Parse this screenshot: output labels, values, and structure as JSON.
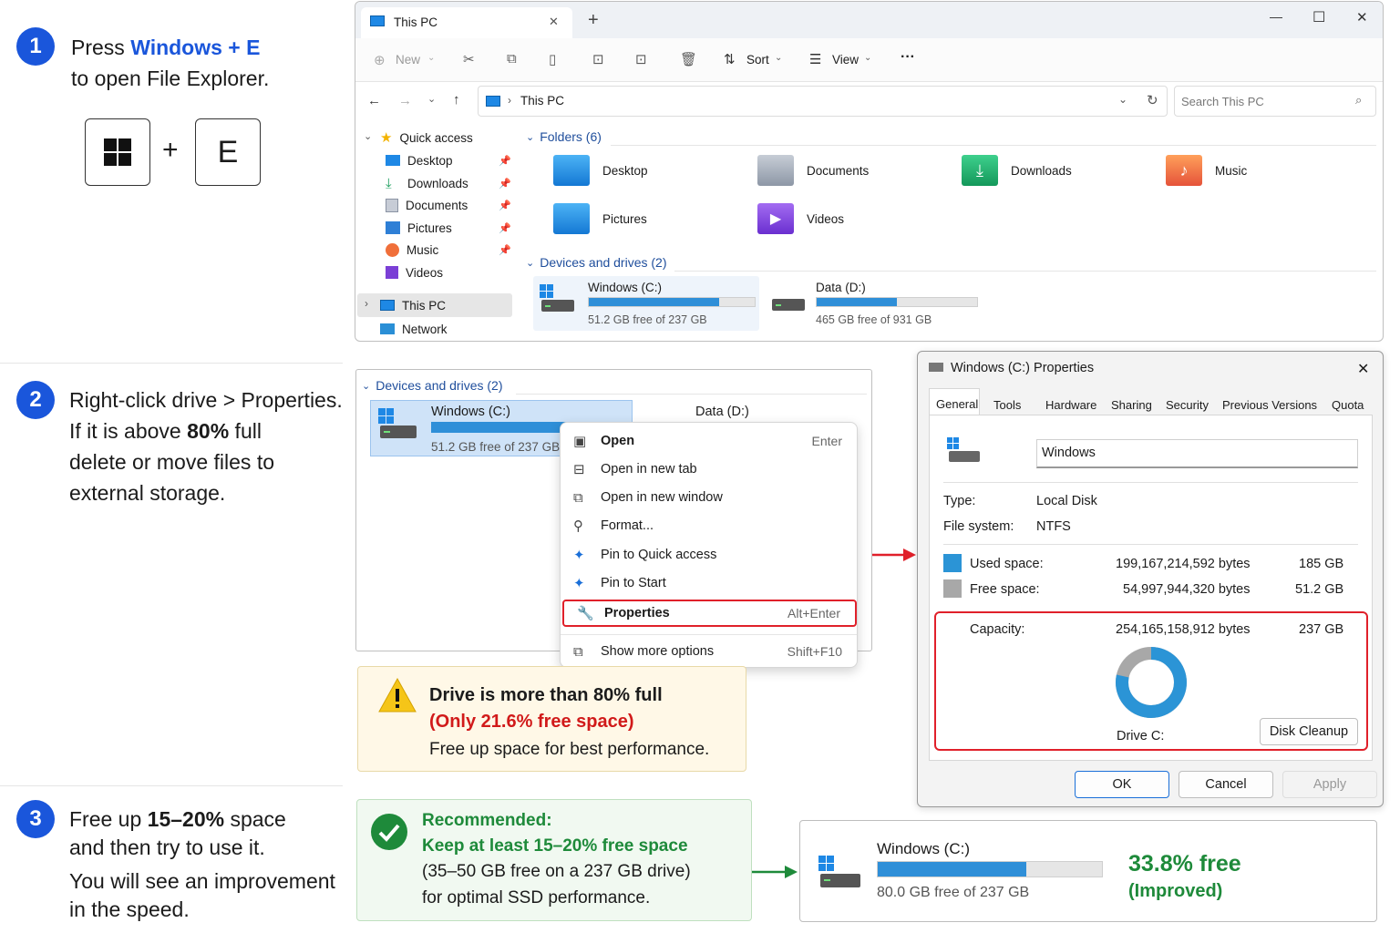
{
  "step1": {
    "num": "1",
    "line1_pre": "Press ",
    "line1_key": "Windows + E",
    "line2": "to open File Explorer.",
    "key_plus": "+",
    "key_e": "E"
  },
  "step2": {
    "num": "2",
    "line1": "Right-click drive > Properties.",
    "line2_pre": "If it is above ",
    "line2_bold": "80%",
    "line2_post": " full",
    "line3": "delete or move files to",
    "line4": "external storage."
  },
  "step3": {
    "num": "3",
    "line1_pre": "Free up ",
    "line1_bold": "15–20%",
    "line1_post": " space",
    "line2": "and then try to use it.",
    "line3": "You will see an improvement",
    "line4": "in the speed."
  },
  "explorer": {
    "tab_title": "This PC",
    "new_tab": "+",
    "window_controls": {
      "minimize": "—",
      "maximize": "☐",
      "close": "✕"
    },
    "toolbar": {
      "new": "New",
      "sort": "Sort",
      "view": "View",
      "more": "···"
    },
    "address": "This PC",
    "search_placeholder": "Search This PC",
    "nav": {
      "quick_access": "Quick access",
      "items": [
        "Desktop",
        "Downloads",
        "Documents",
        "Pictures",
        "Music",
        "Videos"
      ],
      "this_pc": "This PC",
      "network": "Network"
    },
    "folders_header": "Folders (6)",
    "folders": [
      "Desktop",
      "Documents",
      "Downloads",
      "Music",
      "Pictures",
      "Videos"
    ],
    "devices_header": "Devices and drives (2)",
    "drives": [
      {
        "name": "Windows (C:)",
        "free": "51.2 GB free of 237 GB",
        "used_fraction": 0.784
      },
      {
        "name": "Data (D:)",
        "free": "465 GB free of 931 GB",
        "used_fraction": 0.5
      }
    ]
  },
  "context": {
    "devices_header": "Devices and drives (2)",
    "drive_c": "Windows (C:)",
    "drive_c_free": "51.2 GB free of 237 GB",
    "drive_d": "Data (D:)",
    "menu": [
      {
        "label": "Open",
        "shortcut": "Enter",
        "icon": "open-icon"
      },
      {
        "label": "Open in new tab",
        "shortcut": "",
        "icon": "new-tab-icon"
      },
      {
        "label": "Open in new window",
        "shortcut": "",
        "icon": "new-window-icon"
      },
      {
        "label": "Format...",
        "shortcut": "",
        "icon": "format-icon"
      },
      {
        "label": "Pin to Quick access",
        "shortcut": "",
        "icon": "pin-icon"
      },
      {
        "label": "Pin to Start",
        "shortcut": "",
        "icon": "pin-icon"
      },
      {
        "label": "Properties",
        "shortcut": "Alt+Enter",
        "icon": "wrench-icon"
      },
      {
        "label": "Show more options",
        "shortcut": "Shift+F10",
        "icon": "more-options-icon"
      }
    ]
  },
  "properties": {
    "title": "Windows (C:) Properties",
    "close": "✕",
    "tabs": [
      "General",
      "Tools",
      "Hardware",
      "Sharing",
      "Security",
      "Previous Versions",
      "Quota"
    ],
    "name_value": "Windows",
    "type_label": "Type:",
    "type_value": "Local Disk",
    "fs_label": "File system:",
    "fs_value": "NTFS",
    "used_label": "Used space:",
    "used_bytes": "199,167,214,592 bytes",
    "used_gb": "185 GB",
    "free_label": "Free space:",
    "free_bytes": "54,997,944,320 bytes",
    "free_gb": "51.2 GB",
    "cap_label": "Capacity:",
    "cap_bytes": "254,165,158,912 bytes",
    "cap_gb": "237 GB",
    "drive_label": "Drive C:",
    "disk_cleanup": "Disk Cleanup",
    "ok": "OK",
    "cancel": "Cancel",
    "apply": "Apply",
    "used_fraction": 0.784,
    "colors": {
      "used": "#2b94d6",
      "free": "#a8a8a8"
    }
  },
  "warning": {
    "title": "Drive is more than 80% full",
    "sub": "(Only 21.6% free space)",
    "body": "Free up space for best performance."
  },
  "recommend": {
    "title": "Recommended:",
    "line1": "Keep at least 15–20% free space",
    "line2": "(35–50 GB free on a 237 GB drive)",
    "line3": "for optimal SSD performance."
  },
  "result": {
    "name": "Windows (C:)",
    "free": "80.0 GB free of 237 GB",
    "pct": "33.8% free",
    "improved": "(Improved)",
    "used_fraction": 0.662
  }
}
